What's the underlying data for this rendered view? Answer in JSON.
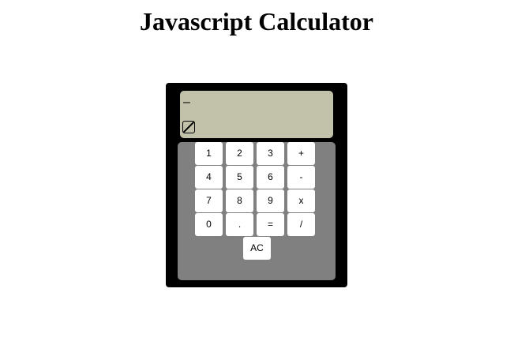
{
  "page": {
    "title": "Javascript Calculator"
  },
  "display": {
    "value": "–"
  },
  "keypad": {
    "rows": [
      [
        "1",
        "2",
        "3",
        "+"
      ],
      [
        "4",
        "5",
        "6",
        "-"
      ],
      [
        "7",
        "8",
        "9",
        "x"
      ],
      [
        "0",
        ".",
        "=",
        "/"
      ]
    ],
    "clear_label": "AC"
  },
  "colors": {
    "calculator_body": "#000000",
    "display_background": "#c2c2aa",
    "keypad_background": "#808080",
    "key_background": "#ffffff"
  }
}
